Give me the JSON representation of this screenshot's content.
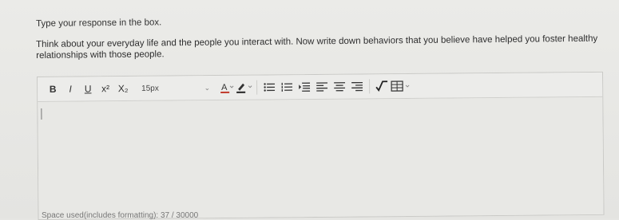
{
  "instruction": "Type your response in the box.",
  "prompt": "Think about your everyday life and the people you interact with. Now write down behaviors that you believe have helped you foster healthy relationships with those people.",
  "toolbar": {
    "bold_label": "B",
    "italic_label": "I",
    "underline_label": "U",
    "superscript_label": "x²",
    "subscript_label": "X₂",
    "font_size": "15px",
    "icons": [
      "font-color-icon",
      "highlight-icon",
      "bullet-list-icon",
      "numbered-list-icon",
      "indent-icon",
      "align-left-icon",
      "align-center-icon",
      "align-right-icon",
      "math-icon",
      "table-icon"
    ]
  },
  "editor": {
    "value": ""
  },
  "footer": {
    "text": "Space used(includes formatting): 37 / 30000"
  }
}
